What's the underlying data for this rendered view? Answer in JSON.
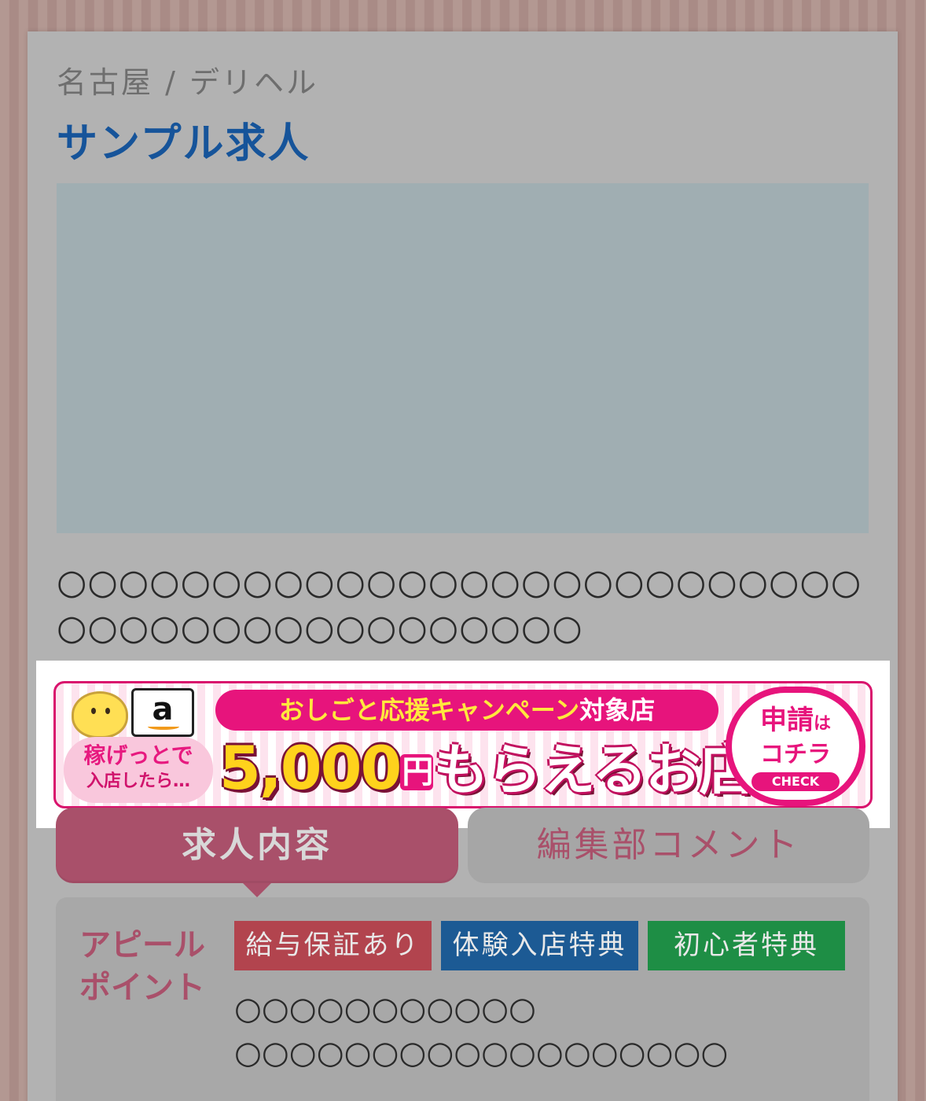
{
  "breadcrumb": "名古屋 / デリヘル",
  "title": "サンプル求人",
  "description": "○○○○○○○○○○○○○○○○○○○○○○○○○○○○○○○○○○○○○○○○○○○",
  "banner": {
    "earn_line1": "稼げっとで",
    "earn_line2": "入店したら…",
    "amazon_letter": "a",
    "campaign_main": "おしごと応援キャンペーン",
    "campaign_tail": "対象店",
    "amount": "5,000",
    "yen": "円",
    "amount_tail": "もらえるお店",
    "apply_line1": "申請",
    "apply_ha": "は",
    "apply_line2": "コチラ",
    "apply_check": "CHECK"
  },
  "tabs": {
    "job": "求人内容",
    "comment": "編集部コメント"
  },
  "appeal": {
    "label_line1": "アピール",
    "label_line2": "ポイント",
    "tags": [
      "給与保証あり",
      "体験入店特典",
      "初心者特典"
    ],
    "text_line1": "○○○○○○○○○○○",
    "text_line2": "○○○○○○○○○○○○○○○○○○"
  }
}
